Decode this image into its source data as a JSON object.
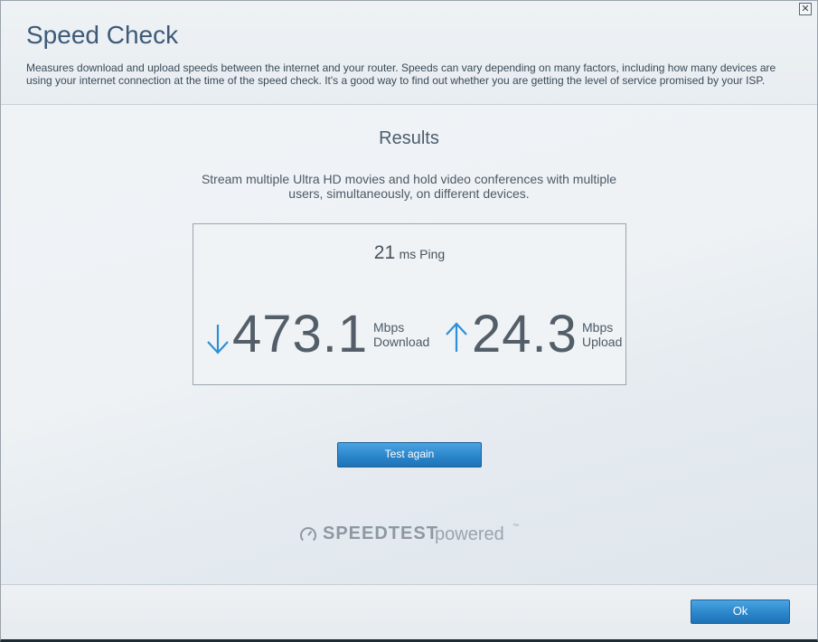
{
  "dialog": {
    "close_glyph": "✕",
    "title": "Speed Check",
    "description": "Measures download and upload speeds between the internet and your router. Speeds can vary depending on many factors, including how many devices are using your internet connection at the time of the speed check. It's a good way to find out whether you are getting the level of service promised by your ISP."
  },
  "results": {
    "heading": "Results",
    "description": "Stream multiple Ultra HD movies and hold video conferences with multiple users, simultaneously, on different devices.",
    "ping": {
      "value": "21",
      "unit": "ms Ping"
    },
    "download": {
      "value": "473.1",
      "unit": "Mbps",
      "label": "Download",
      "icon": "down-arrow-icon"
    },
    "upload": {
      "value": "24.3",
      "unit": "Mbps",
      "label": "Upload",
      "icon": "up-arrow-icon"
    }
  },
  "buttons": {
    "test_again": "Test again",
    "ok": "Ok"
  },
  "branding": {
    "speedtest_word": "SPEEDTEST",
    "powered_word": "powered",
    "trademark": "™",
    "icon": "speedometer-icon"
  },
  "colors": {
    "title": "#3d5a78",
    "accent_blue": "#2b86cb",
    "arrow_blue": "#2f8fd6",
    "number_gray": "#535e68"
  }
}
